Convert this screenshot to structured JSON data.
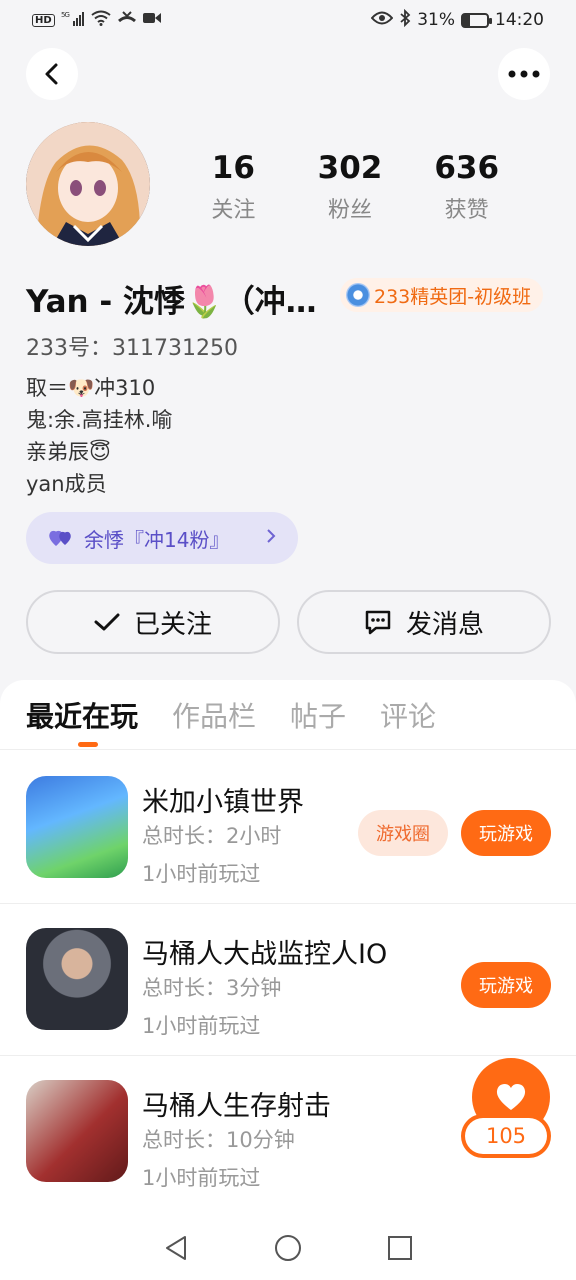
{
  "status_bar": {
    "hd": "HD",
    "network": "5G",
    "battery_text": "31%",
    "battery_level": 0.31,
    "time": "14:20"
  },
  "profile": {
    "stats": [
      {
        "value": "16",
        "label": "关注"
      },
      {
        "value": "302",
        "label": "粉丝"
      },
      {
        "value": "636",
        "label": "获赞"
      }
    ],
    "name": "Yan - 沈悸🌷（冲…",
    "badge": "233精英团-初级班",
    "id_text": "233号：311731250",
    "bio": [
      "取＝🐶冲310",
      "鬼:余.高挂林.喻",
      "亲弟辰😇",
      "yan成员"
    ],
    "fan_group": "余悸『冲14粉』",
    "follow_label": "已关注",
    "message_label": "发消息"
  },
  "tabs": [
    {
      "label": "最近在玩",
      "active": true
    },
    {
      "label": "作品栏",
      "active": false
    },
    {
      "label": "帖子",
      "active": false
    },
    {
      "label": "评论",
      "active": false
    }
  ],
  "games": [
    {
      "title": "米加小镇世界",
      "duration": "总时长：2小时",
      "last_played": "1小时前玩过",
      "circle_label": "游戏圈",
      "play_label": "玩游戏"
    },
    {
      "title": "马桶人大战监控人IO",
      "duration": "总时长：3分钟",
      "last_played": "1小时前玩过",
      "play_label": "玩游戏"
    },
    {
      "title": "马桶人生存射击",
      "duration": "总时长：10分钟",
      "last_played": "1小时前玩过"
    }
  ],
  "like_count": "105",
  "colors": {
    "accent": "#ff6a14",
    "fan_group_bg": "#e4e3f7",
    "fan_group_text": "#5a4fc7"
  }
}
